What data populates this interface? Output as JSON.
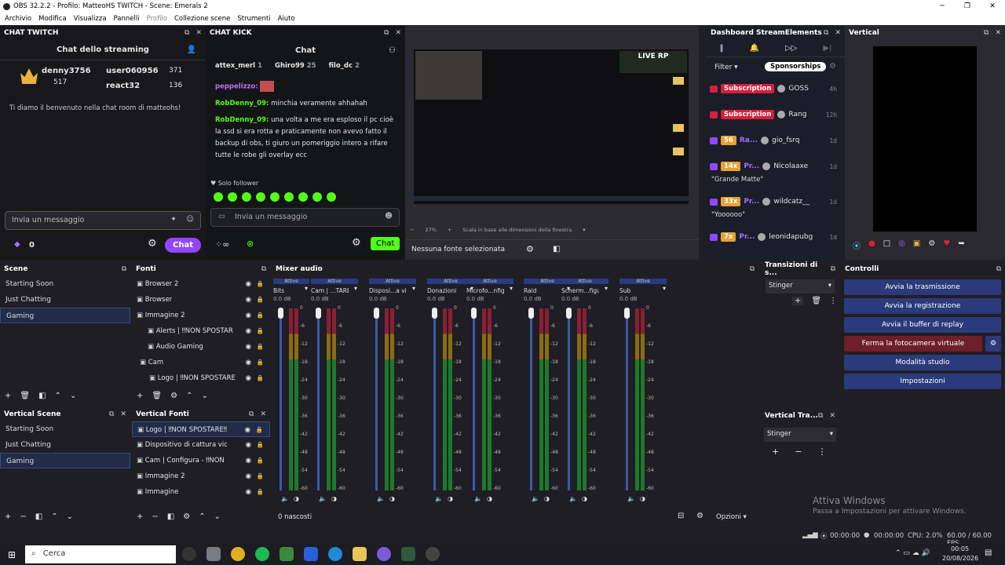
{
  "titlebar": {
    "text": "OBS 32.2.2 - Profilo: MatteoHS TWITCH - Scene: Emerals 2"
  },
  "menu": [
    "Archivio",
    "Modifica",
    "Visualizza",
    "Pannelli",
    "Profilo",
    "Collezione scene",
    "Strumenti",
    "Aiuto"
  ],
  "twitch": {
    "dock_title": "CHAT TWITCH",
    "header": "Chat dello streaming",
    "users": [
      {
        "name": "denny3756",
        "count": "517"
      },
      {
        "name": "user060956",
        "count": "371"
      },
      {
        "name": "react32",
        "count": "136"
      }
    ],
    "welcome": "Ti diamo il benvenuto nella chat room di matteohs!",
    "placeholder": "Invia un messaggio",
    "points": "0",
    "chat_btn": "Chat"
  },
  "kick": {
    "dock_title": "CHAT KICK",
    "header": "Chat",
    "top": [
      {
        "name": "attex_merl",
        "n": "1"
      },
      {
        "name": "Ghiro99",
        "n": "25"
      },
      {
        "name": "filo_dc",
        "n": "2"
      }
    ],
    "messages": [
      {
        "user": "peppelizzo:",
        "text": ""
      },
      {
        "user": "RobDenny_09:",
        "text": "minchia veramente ahhahah"
      },
      {
        "user": "RobDenny_09:",
        "text": "una volta a me era esploso il pc cioè la ssd si era rotta e praticamente non avevo fatto il backup di obs, ti giuro un pomeriggio intero a rifare tutte le robe gli overlay ecc"
      }
    ],
    "follower": "Solo follower",
    "placeholder": "Invia un messaggio",
    "chat_btn": "Chat"
  },
  "preview": {
    "zoom": "27%",
    "scale_label": "Scala in base alle dimensioni della finestra",
    "no_source": "Nessuna fonte selezionata"
  },
  "se": {
    "dock_title": "Dashboard StreamElements",
    "filter": "Filter",
    "sponsor": "Sponsorships",
    "rows": [
      {
        "badge": "Subscription",
        "color": "#d4203a",
        "name": "GOSS",
        "ago": "4h"
      },
      {
        "badge": "Subscription",
        "color": "#d4203a",
        "name": "Rang",
        "ago": "12h"
      },
      {
        "badge": "56",
        "color": "#9147ff",
        "extra": "Ra...",
        "name": "gio_fsrq",
        "ago": "1d"
      },
      {
        "badge": "14x",
        "color": "#9147ff",
        "extra": "Pr...",
        "name": "Nicolaaxe",
        "ago": "1d",
        "quote": "\"Grande Matte\""
      },
      {
        "badge": "33x",
        "color": "#9147ff",
        "extra": "Pr...",
        "name": "wildcatz__",
        "ago": "1d",
        "quote": "\"Yoooooo\""
      },
      {
        "badge": "7x",
        "color": "#9147ff",
        "extra": "Pr...",
        "name": "leonidapubg",
        "ago": "1d"
      }
    ]
  },
  "vertical": {
    "dock_title": "Vertical"
  },
  "scene": {
    "title": "Scene",
    "items": [
      "Starting Soon",
      "Just Chatting",
      "Gaming"
    ]
  },
  "fonti": {
    "title": "Fonti",
    "items": [
      "Browser 2",
      "Browser",
      "Immagine 2",
      "Alerts | ‼NON SPOSTAR",
      "Audio Gaming",
      "Cam",
      "Logo | ‼NON SPOSTARE"
    ]
  },
  "vscene": {
    "title": "Vertical Scene",
    "items": [
      "Starting Soon",
      "Just Chatting",
      "Gaming"
    ]
  },
  "vfonti": {
    "title": "Vertical Fonti",
    "items": [
      "Logo | ‼NON SPOSTARE‼",
      "Dispositivo di cattura vide",
      "Cam | Configura - ‼NON S",
      "Immagine 2",
      "Immagine"
    ]
  },
  "mixer": {
    "title": "Mixer audio",
    "hidden": "0 nascosti",
    "options": "Opzioni",
    "active": "Attive",
    "db": "0.0 dB",
    "channels": [
      "Bits",
      "Cam | ...TARE‼",
      "Disposi...a video",
      "Donazioni",
      "Microfo...nfigura",
      "Raid",
      "Scherm...figura",
      "Sub"
    ],
    "ticks": [
      "0",
      "-6",
      "-12",
      "-18",
      "-24",
      "-30",
      "-36",
      "-42",
      "-48",
      "-54",
      "-60"
    ]
  },
  "transitions": {
    "title": "Transizioni di s...",
    "value": "Stinger"
  },
  "vtransitions": {
    "title": "Vertical Tra...",
    "value": "Stinger"
  },
  "controls": {
    "title": "Controlli",
    "buttons": [
      "Avvia la trasmissione",
      "Avvia la registrazione",
      "Avvia il buffer di replay",
      "Ferma la fotocamera virtuale",
      "Modalità studio",
      "Impostazioni"
    ]
  },
  "watermark": {
    "line1": "Attiva Windows",
    "line2": "Passa a Impostazioni per attivare Windows."
  },
  "status": {
    "t1": "00:00:00",
    "t2": "00:00:00",
    "cpu": "CPU: 2.0%",
    "fps": "60.00 / 60.00 FPS"
  },
  "taskbar": {
    "search": "Cerca",
    "time": "00:05",
    "date": "20/08/2026"
  }
}
